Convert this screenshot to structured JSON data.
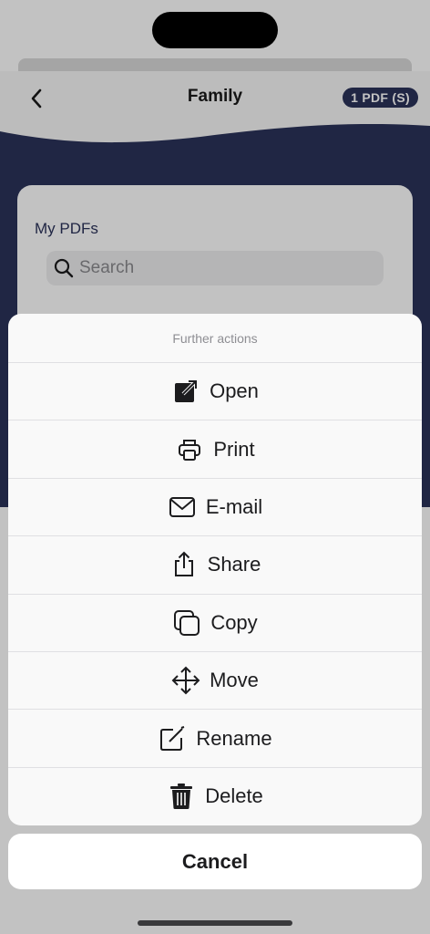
{
  "navbar": {
    "title": "Family",
    "badge": "1 PDF (S)",
    "back_icon": "chevron-left-icon"
  },
  "card": {
    "title": "My PDFs",
    "search_placeholder": "Search"
  },
  "action_sheet": {
    "header": "Further actions",
    "items": [
      {
        "label": "Open",
        "icon": "open-external-icon"
      },
      {
        "label": "Print",
        "icon": "printer-icon"
      },
      {
        "label": "E-mail",
        "icon": "envelope-icon"
      },
      {
        "label": "Share",
        "icon": "share-icon"
      },
      {
        "label": "Copy",
        "icon": "copy-icon"
      },
      {
        "label": "Move",
        "icon": "move-arrows-icon"
      },
      {
        "label": "Rename",
        "icon": "rename-icon"
      },
      {
        "label": "Delete",
        "icon": "trash-icon"
      }
    ],
    "cancel": "Cancel"
  },
  "colors": {
    "brand": "#2b325a",
    "text": "#1c1c1e",
    "muted": "#8e8e93"
  }
}
